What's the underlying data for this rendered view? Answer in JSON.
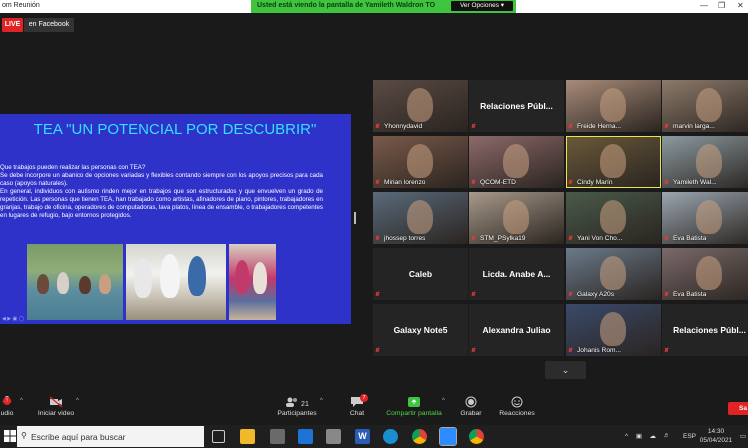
{
  "window": {
    "title": "om Reunión"
  },
  "share_banner": {
    "text": "Usted está viendo la pantalla de Yamileth Waldron TO",
    "view_options": "Ver Opciones"
  },
  "live": {
    "badge": "LIVE",
    "platform": "en Facebook"
  },
  "slide": {
    "title": "TEA \"UN POTENCIAL POR DESCUBRIR\"",
    "body": [
      "Que trabajos pueden realizar las personas con TEA?",
      "Se debe incorpore un abanico de opciones variadas y flexibles contando siempre con los apoyos precisos para cada caso (apoyos naturales).",
      "En general, individuos con autismo rinden mejor en trabajos que son estructurados y que envuelven un grado de repetición. Las personas que tienen TEA, han trabajado como artistas, afinadores de piano, pintores, trabajadores en granjas, trabajo de oficina, operadores de computadoras, lava platos, línea de ensamble, o trabajadores competentes en lugares de refugio, bajo entornos protegidos."
    ]
  },
  "participants": [
    {
      "name": "Yhonnydavid",
      "type": "video",
      "color": "#5a4a44"
    },
    {
      "name": "Relaciones Públ...",
      "type": "name"
    },
    {
      "name": "Freide Herna...",
      "type": "video",
      "color": "#a88c7a"
    },
    {
      "name": "marvin larga...",
      "type": "video",
      "color": "#8c7a6a"
    },
    {
      "name": "Mirian lorenzo",
      "type": "video",
      "color": "#7a5a4a"
    },
    {
      "name": "QCOM-ETD",
      "type": "video",
      "color": "#8c6a6a"
    },
    {
      "name": "Cindy Marín",
      "type": "video",
      "color": "#6a5a3a",
      "active": true
    },
    {
      "name": "Yamileth Wal...",
      "type": "video",
      "color": "#8c9aa0"
    },
    {
      "name": "jhossep torres",
      "type": "video",
      "color": "#5a6a7a"
    },
    {
      "name": "STM_PSylka19",
      "type": "video",
      "color": "#a89a8a"
    },
    {
      "name": "Yani Von Cho...",
      "type": "video",
      "color": "#4a5a4a"
    },
    {
      "name": "Eva Batista",
      "type": "video",
      "color": "#9aa6b0"
    },
    {
      "name": "Caleb",
      "type": "name"
    },
    {
      "name": "Licda. Anabe A...",
      "type": "name"
    },
    {
      "name": "Galaxy A20s",
      "type": "video",
      "color": "#6a7a8a"
    },
    {
      "name": "Eva Batista",
      "type": "video",
      "color": "#7a6a6a"
    },
    {
      "name": "Galaxy Note5",
      "type": "name"
    },
    {
      "name": "Alexandra Juliao",
      "type": "name"
    },
    {
      "name": "Johanis Rom...",
      "type": "video",
      "color": "#3a4a6a"
    },
    {
      "name": "Relaciones Públ...",
      "type": "name"
    }
  ],
  "toolbar": {
    "audio": "udio",
    "video": "Iniciar video",
    "participants": "Participantes",
    "participants_count": "21",
    "chat": "Chat",
    "chat_badge": "7",
    "share": "Compartir pantalla",
    "record": "Grabar",
    "reactions": "Reacciones",
    "end": "Sa"
  },
  "taskbar": {
    "search_placeholder": "Escribe aquí para buscar",
    "language": "ESP",
    "time": "14:30",
    "date": "05/04/2021"
  },
  "colors": {
    "slide_bg": "#2f32c8",
    "slide_title": "#33e0ff",
    "banner": "#3ec43e",
    "live": "#e02424",
    "active_speaker": "#e8e84c"
  }
}
